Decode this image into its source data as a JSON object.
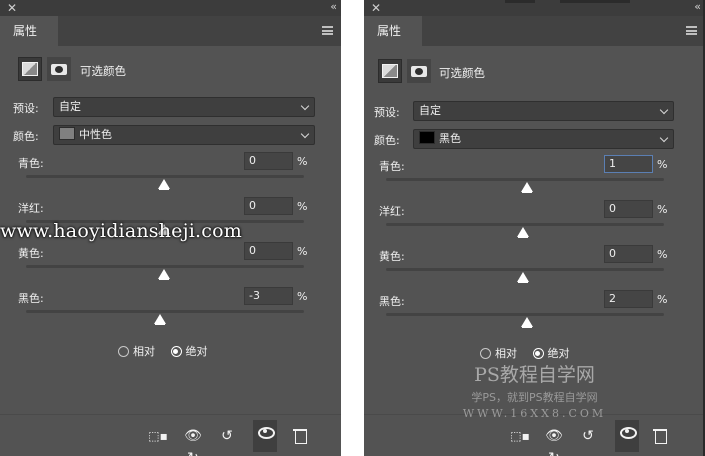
{
  "watermark_site": "www.haoyidiansheji.com",
  "watermark_ps": {
    "title": "PS教程自学网",
    "slogan": "学PS，就到PS教程自学网",
    "url": "WWW.16XX8.COM"
  },
  "panels": [
    {
      "tab": "属性",
      "title": "可选颜色",
      "preset_label": "预设:",
      "preset_value": "自定",
      "color_label": "颜色:",
      "color_value": "中性色",
      "swatch": "#808080",
      "sliders": [
        {
          "label": "青色:",
          "value": "0",
          "pct": 0
        },
        {
          "label": "洋红:",
          "value": "0",
          "pct": 0
        },
        {
          "label": "黄色:",
          "value": "0",
          "pct": 0
        },
        {
          "label": "黑色:",
          "value": "-3",
          "pct": -3
        }
      ],
      "unit": "%",
      "method": {
        "relative": "相对",
        "absolute": "绝对",
        "selected": "absolute"
      }
    },
    {
      "tab": "属性",
      "title": "可选颜色",
      "preset_label": "预设:",
      "preset_value": "自定",
      "color_label": "颜色:",
      "color_value": "黑色",
      "swatch": "#000000",
      "sliders": [
        {
          "label": "青色:",
          "value": "1",
          "pct": 1
        },
        {
          "label": "洋红:",
          "value": "0",
          "pct": 0
        },
        {
          "label": "黄色:",
          "value": "0",
          "pct": 0
        },
        {
          "label": "黑色:",
          "value": "2",
          "pct": 2
        }
      ],
      "unit": "%",
      "method": {
        "relative": "相对",
        "absolute": "绝对",
        "selected": "absolute"
      }
    }
  ],
  "colors": {
    "panel_bg": "#535353",
    "field_bg": "#3f3f3f",
    "focus": "#5b7fb3"
  }
}
